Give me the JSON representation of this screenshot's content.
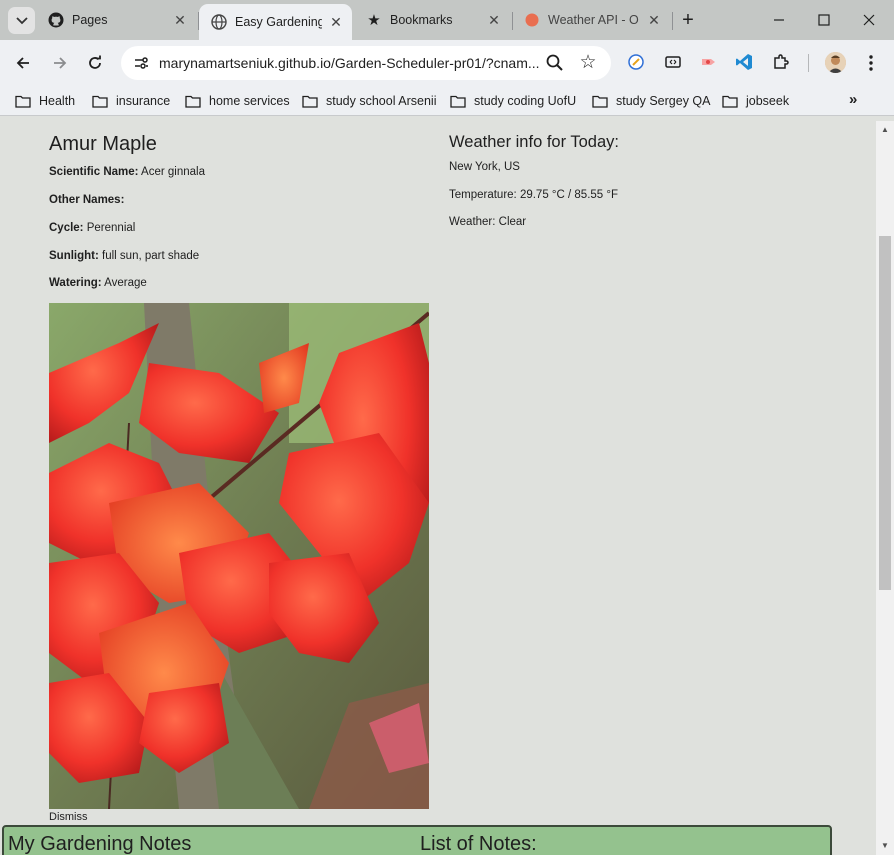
{
  "tabs": [
    {
      "title": "Pages",
      "icon": "github-icon",
      "active": false
    },
    {
      "title": "Easy Gardening",
      "icon": "globe-icon",
      "active": true
    },
    {
      "title": "Bookmarks",
      "icon": "star-icon",
      "active": false
    },
    {
      "title": "Weather API - O",
      "icon": "openweather-icon",
      "active": false
    }
  ],
  "toolbar": {
    "url": "marynamartseniuk.github.io/Garden-Scheduler-pr01/?cnam..."
  },
  "bookmarks": [
    {
      "label": "Health"
    },
    {
      "label": "insurance"
    },
    {
      "label": "home services"
    },
    {
      "label": "study school Arsenii"
    },
    {
      "label": "study coding UofU"
    },
    {
      "label": "study Sergey QA"
    },
    {
      "label": "jobseek"
    }
  ],
  "plant": {
    "name": "Amur Maple",
    "scientific_label": "Scientific Name:",
    "scientific_value": "Acer ginnala",
    "other_label": "Other Names:",
    "other_value": "",
    "cycle_label": "Cycle:",
    "cycle_value": "Perennial",
    "sunlight_label": "Sunlight:",
    "sunlight_value": "full sun, part shade",
    "watering_label": "Watering:",
    "watering_value": "Average",
    "dismiss": "Dismiss"
  },
  "weather": {
    "title": "Weather info for Today:",
    "location": "New York, US",
    "temperature": "Temperature: 29.75 °C / 85.55 °F",
    "condition": "Weather: Clear"
  },
  "notes": {
    "title": "My Gardening Notes",
    "list_title": "List of Notes:"
  },
  "colors": {
    "page_bg": "#dfe1dd",
    "notes_bg": "#94c28e",
    "chrome_bg": "#eef0f3",
    "tabstrip_bg": "#c4c7c5"
  }
}
